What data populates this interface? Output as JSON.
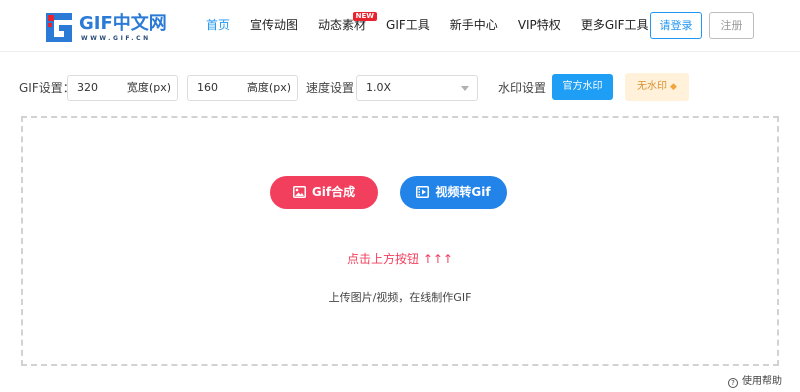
{
  "header": {
    "logo": {
      "title": "GIF中文网",
      "subtitle": "WWW.GIF.CN",
      "mark_color": "#2a7ad6",
      "accent_color": "#e8232d"
    },
    "nav": [
      {
        "label": "首页",
        "active": true
      },
      {
        "label": "宣传动图",
        "active": false
      },
      {
        "label": "动态素材",
        "active": false,
        "badge": "NEW"
      },
      {
        "label": "GIF工具",
        "active": false
      },
      {
        "label": "新手中心",
        "active": false
      },
      {
        "label": "VIP特权",
        "active": false
      },
      {
        "label": "更多GIF工具",
        "active": false
      }
    ],
    "login_label": "请登录",
    "register_label": "注册"
  },
  "settings": {
    "gif_label": "GIF设置：",
    "width_value": "320",
    "width_unit": "宽度(px)",
    "height_value": "160",
    "height_unit": "高度(px)",
    "speed_label": "速度设置：",
    "speed_value": "1.0X",
    "watermark_label": "水印设置",
    "official_watermark": "官方水印",
    "no_watermark": "无水印",
    "diamond_icon": "diamond-icon"
  },
  "upload": {
    "gif_button": "Gif合成",
    "video_button": "视频转Gif",
    "hint_primary": "点击上方按钮 ↑↑↑",
    "hint_secondary": "上传图片/视频，在线制作GIF"
  },
  "footer": {
    "help_label": "使用帮助"
  },
  "colors": {
    "primary": "#2196f3",
    "red": "#f13f5d",
    "blue_button": "#2283e8",
    "gold": "#d9922f"
  }
}
